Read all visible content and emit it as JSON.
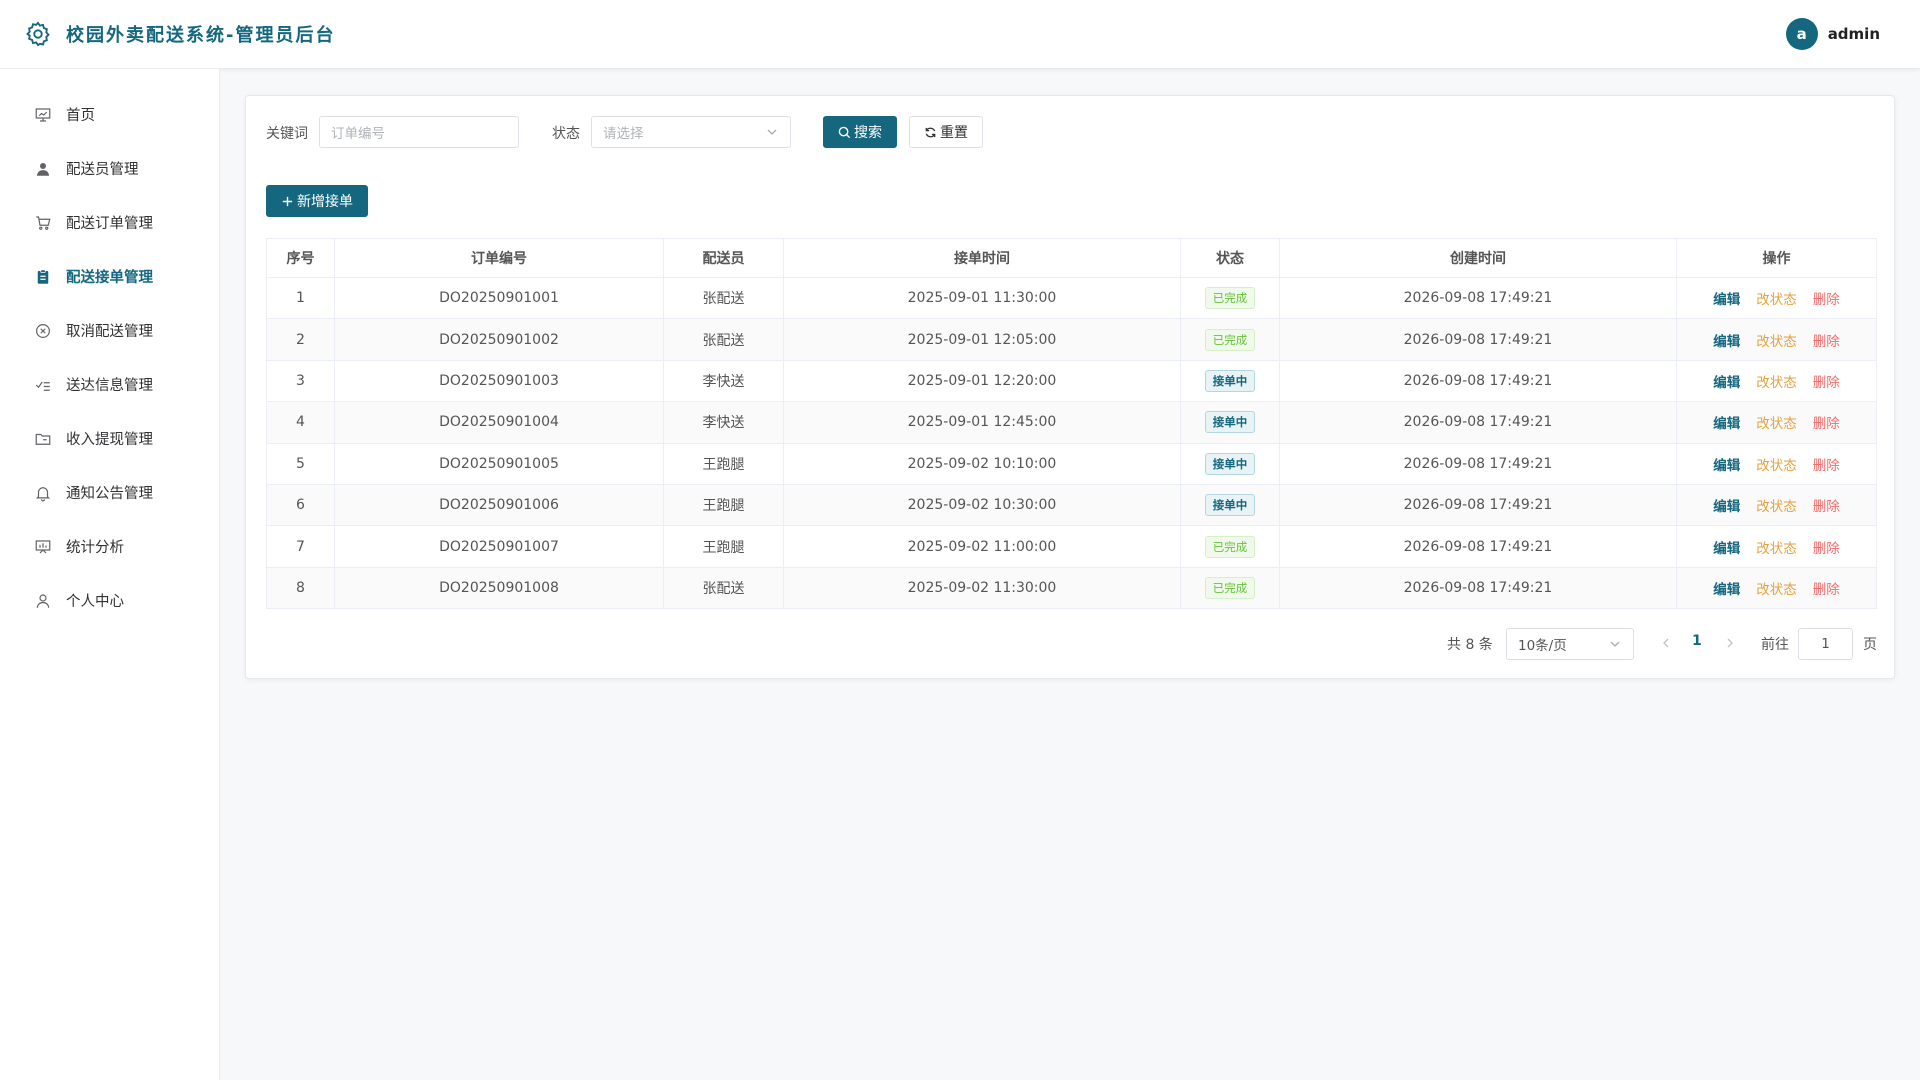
{
  "app": {
    "title": "校园外卖配送系统-管理员后台",
    "username": "admin",
    "avatar_letter": "a",
    "accent_color": "#15677f"
  },
  "sidebar": {
    "items": [
      {
        "label": "首页",
        "icon": "home-dashboard-icon",
        "active": false
      },
      {
        "label": "配送员管理",
        "icon": "user-icon",
        "active": false
      },
      {
        "label": "配送订单管理",
        "icon": "cart-icon",
        "active": false
      },
      {
        "label": "配送接单管理",
        "icon": "clipboard-icon",
        "active": true
      },
      {
        "label": "取消配送管理",
        "icon": "cancel-circle-icon",
        "active": false
      },
      {
        "label": "送达信息管理",
        "icon": "checklist-icon",
        "active": false
      },
      {
        "label": "收入提现管理",
        "icon": "folder-icon",
        "active": false
      },
      {
        "label": "通知公告管理",
        "icon": "bell-icon",
        "active": false
      },
      {
        "label": "统计分析",
        "icon": "chart-board-icon",
        "active": false
      },
      {
        "label": "个人中心",
        "icon": "person-icon",
        "active": false
      }
    ]
  },
  "filters": {
    "keyword_label": "关键词",
    "keyword_placeholder": "订单编号",
    "status_label": "状态",
    "status_placeholder": "请选择",
    "search_label": "搜索",
    "reset_label": "重置"
  },
  "actions": {
    "add_label": "新增接单"
  },
  "table": {
    "columns": [
      "序号",
      "订单编号",
      "配送员",
      "接单时间",
      "状态",
      "创建时间",
      "操作"
    ],
    "op_labels": {
      "edit": "编辑",
      "change_status": "改状态",
      "delete": "删除"
    },
    "rows": [
      {
        "no": "1",
        "order": "DO20250901001",
        "courier": "张配送",
        "accepted": "2025-09-01 11:30:00",
        "status": "已完成",
        "status_type": "done",
        "created": "2026-09-08 17:49:21"
      },
      {
        "no": "2",
        "order": "DO20250901002",
        "courier": "张配送",
        "accepted": "2025-09-01 12:05:00",
        "status": "已完成",
        "status_type": "done",
        "created": "2026-09-08 17:49:21"
      },
      {
        "no": "3",
        "order": "DO20250901003",
        "courier": "李快送",
        "accepted": "2025-09-01 12:20:00",
        "status": "接单中",
        "status_type": "taking",
        "created": "2026-09-08 17:49:21"
      },
      {
        "no": "4",
        "order": "DO20250901004",
        "courier": "李快送",
        "accepted": "2025-09-01 12:45:00",
        "status": "接单中",
        "status_type": "taking",
        "created": "2026-09-08 17:49:21"
      },
      {
        "no": "5",
        "order": "DO20250901005",
        "courier": "王跑腿",
        "accepted": "2025-09-02 10:10:00",
        "status": "接单中",
        "status_type": "taking",
        "created": "2026-09-08 17:49:21"
      },
      {
        "no": "6",
        "order": "DO20250901006",
        "courier": "王跑腿",
        "accepted": "2025-09-02 10:30:00",
        "status": "接单中",
        "status_type": "taking",
        "created": "2026-09-08 17:49:21"
      },
      {
        "no": "7",
        "order": "DO20250901007",
        "courier": "王跑腿",
        "accepted": "2025-09-02 11:00:00",
        "status": "已完成",
        "status_type": "done",
        "created": "2026-09-08 17:49:21"
      },
      {
        "no": "8",
        "order": "DO20250901008",
        "courier": "张配送",
        "accepted": "2025-09-02 11:30:00",
        "status": "已完成",
        "status_type": "done",
        "created": "2026-09-08 17:49:21"
      }
    ]
  },
  "pagination": {
    "total_text": "共 8 条",
    "page_size": "10条/页",
    "current_page": "1",
    "goto_label": "前往",
    "goto_value": "1",
    "page_suffix": "页"
  }
}
